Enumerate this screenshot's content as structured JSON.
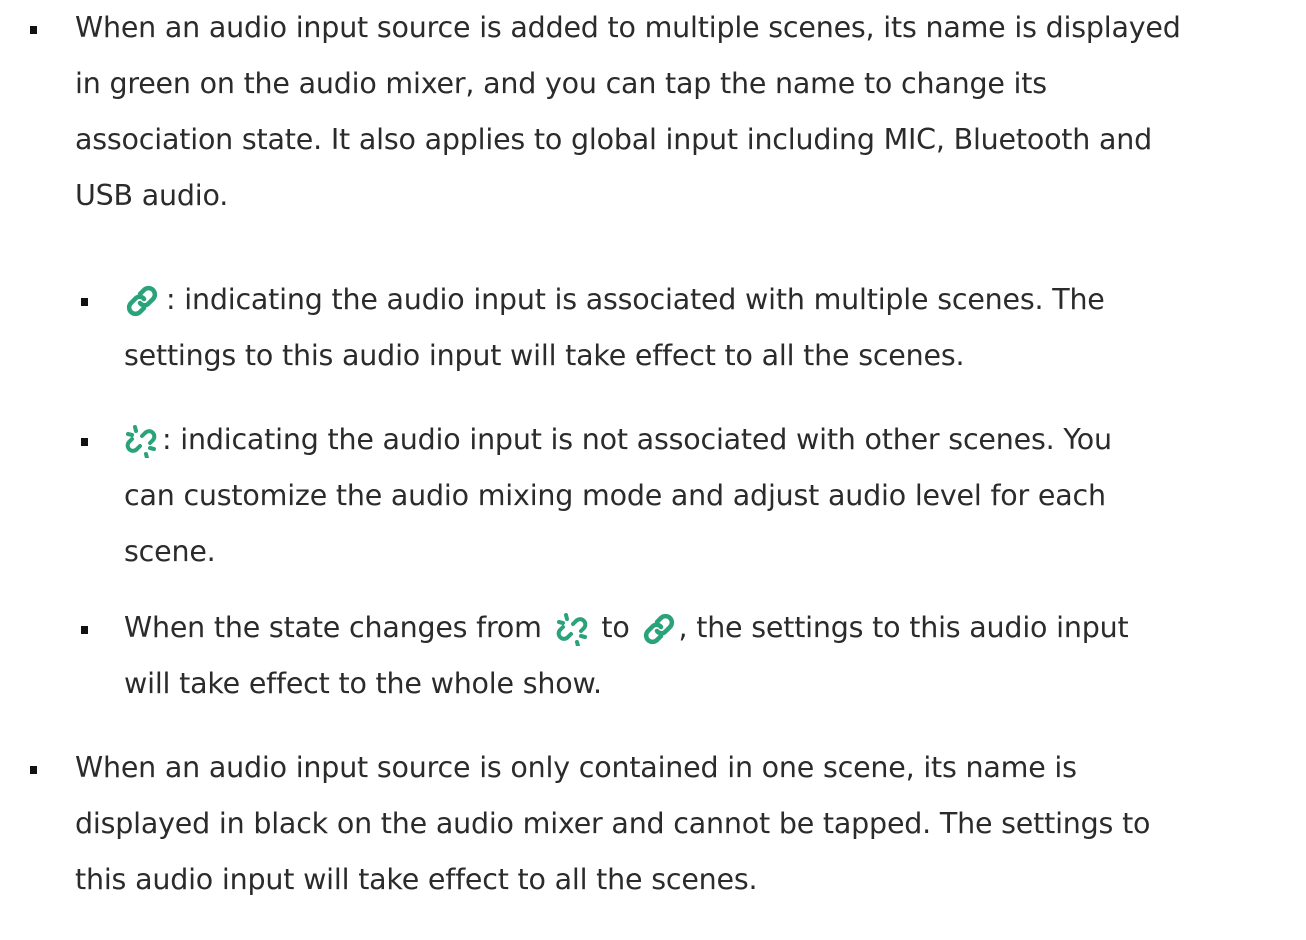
{
  "bullets": [
    {
      "lines": [
        "When an audio input source is added to multiple scenes, its name is displayed",
        "in green on the audio mixer, and you can tap the name to change its",
        "association state. It also applies to global input including MIC, Bluetooth and",
        "USB audio."
      ],
      "sub_bullets": [
        {
          "icon": "link-icon",
          "lines": [
            ": indicating the audio input is associated with multiple scenes. The",
            "settings to this audio input will take effect to all the scenes."
          ]
        },
        {
          "icon": "unlink-icon",
          "lines": [
            ": indicating the audio input is not associated with other scenes. You",
            "can customize the audio mixing mode and adjust audio level for each",
            "scene."
          ]
        },
        {
          "line1_before": "When the state changes from",
          "line1_middle": "to",
          "line1_after": ", the settings to this audio input",
          "line2": "will take effect to the whole show.",
          "icons": [
            "unlink-icon",
            "link-icon"
          ]
        }
      ]
    },
    {
      "lines": [
        "When an audio input source is only contained in one scene, its name is",
        "displayed in black on the audio mixer and cannot be tapped. The settings to",
        "this audio input will take effect to all the scenes."
      ]
    }
  ],
  "colors": {
    "icon_green": "#2aa37a",
    "text": "#2b2b2b",
    "bullet": "#111111"
  }
}
